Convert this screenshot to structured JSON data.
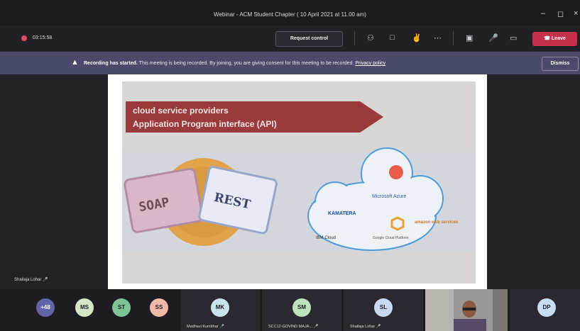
{
  "window": {
    "title": "Webinar - ACM Student Chapter ( 10 April 2021 at 11.00 am)",
    "minimize_icon": "minimize-icon",
    "maximize_icon": "maximize-icon",
    "close_icon": "close-icon"
  },
  "toolbar": {
    "timer": "03:15:58",
    "request_control_label": "Request control",
    "leave_label": "Leave",
    "icons": [
      "participants-icon",
      "chat-icon",
      "reactions-icon",
      "more-icon",
      "camera-off-icon",
      "mic-off-icon",
      "share-icon",
      "phone-icon"
    ],
    "leave_color": "#c4314b"
  },
  "banner": {
    "bold_text": "Recording has started.",
    "text": " This meeting is being recorded. By joining, you are giving consent for this meeting to be recorded. ",
    "link_text": "Privacy policy",
    "dismiss_label": "Dismiss",
    "color": "#4a4a6a"
  },
  "slide": {
    "line1": "cloud service providers",
    "line2": "Application Program interface (API)",
    "soap": "SOAP",
    "rest": "REST",
    "providers": [
      "Microsoft Azure",
      "KAMATERA",
      "IBM Cloud",
      "Google Cloud Platform",
      "amazon web services"
    ]
  },
  "stage": {
    "speaker_name": "Shailaja Lohar"
  },
  "participants": {
    "overflow_count": "+48",
    "avatars": [
      {
        "initials": "MS",
        "color": "#d7e6c8"
      },
      {
        "initials": "ST",
        "color": "#7ec396"
      },
      {
        "initials": "SS",
        "color": "#f3b9a8"
      }
    ],
    "tiles": [
      {
        "initials": "MK",
        "name": "Madhavi Kumbhar",
        "color": "#c9e3ec"
      },
      {
        "initials": "SM",
        "name": "SCC12-GOVIND MAJA...",
        "color": "#bfe3bf"
      },
      {
        "initials": "SL",
        "name": "Shailaja Lohar",
        "color": "#c9d9f1"
      },
      {
        "initials": "DP",
        "name": "",
        "color": "#c9dcf3"
      }
    ]
  }
}
